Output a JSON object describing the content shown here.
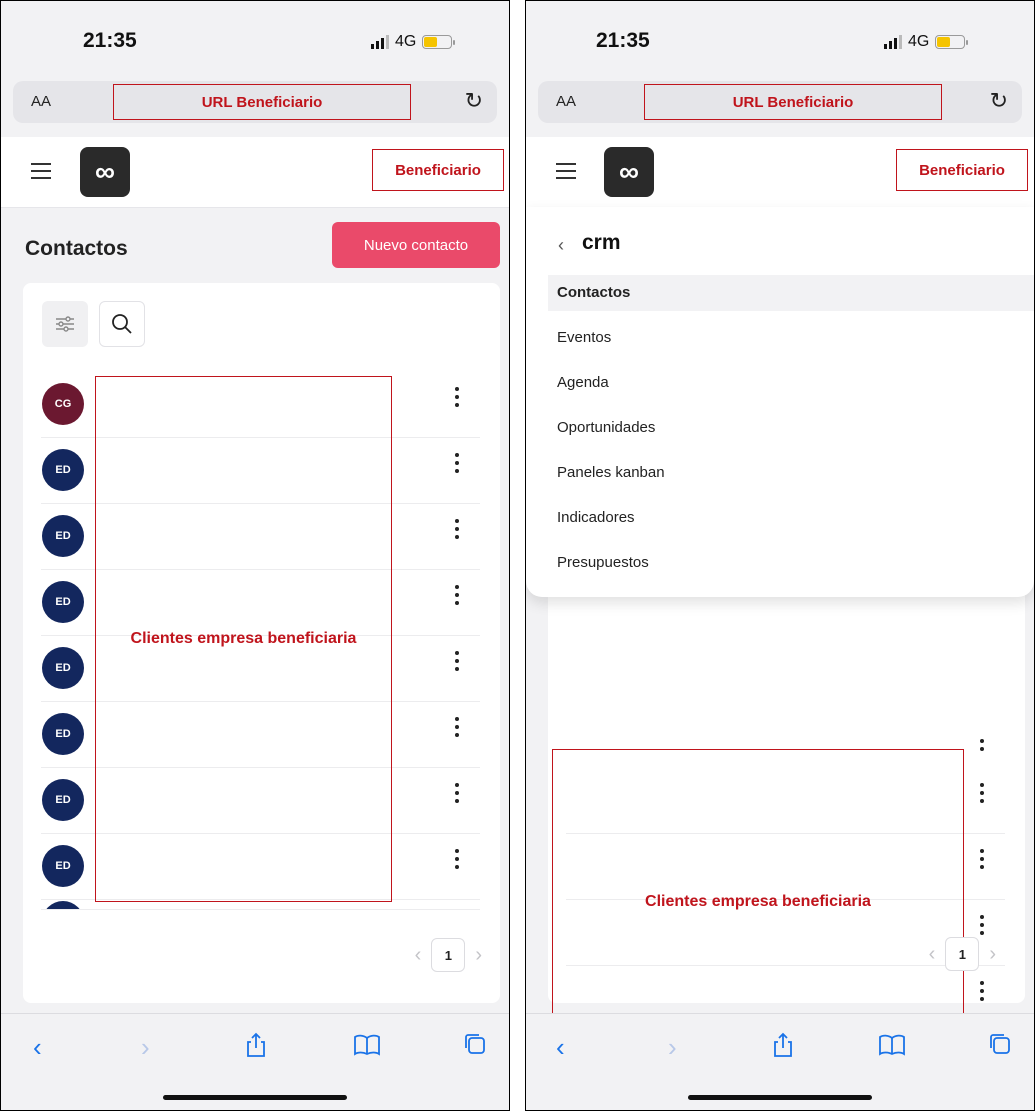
{
  "status": {
    "time": "21:35",
    "network": "4G"
  },
  "browser": {
    "aa_label": "AA",
    "url_label": "URL Beneficiario"
  },
  "header": {
    "account_label": "Beneficiario"
  },
  "page": {
    "title": "Contactos",
    "new_contact_button": "Nuevo contacto"
  },
  "contacts": {
    "avatars": [
      "CG",
      "ED",
      "ED",
      "ED",
      "ED",
      "ED",
      "ED",
      "ED"
    ],
    "colors": {
      "cg": "#6b1830",
      "ed": "#13275e"
    },
    "redacted_label_left": "Clientes empresa beneficiaria",
    "redacted_label_right": "Clientes empresa beneficiaria"
  },
  "pagination": {
    "current_page": "1"
  },
  "menu": {
    "section_title": "crm",
    "items": [
      "Contactos",
      "Eventos",
      "Agenda",
      "Oportunidades",
      "Paneles kanban",
      "Indicadores",
      "Presupuestos"
    ],
    "active_item": "Contactos"
  },
  "colors": {
    "accent": "#ea4a6a",
    "annotation_red": "#c0141c",
    "safari_blue": "#1a73e8"
  },
  "icons": [
    "hamburger-icon",
    "app-logo-icon",
    "filter-icon",
    "search-icon",
    "kebab-icon",
    "chevron-left-icon",
    "chevron-right-icon",
    "share-icon",
    "bookmarks-icon",
    "tabs-icon",
    "reload-icon",
    "signal-icon",
    "battery-icon"
  ]
}
